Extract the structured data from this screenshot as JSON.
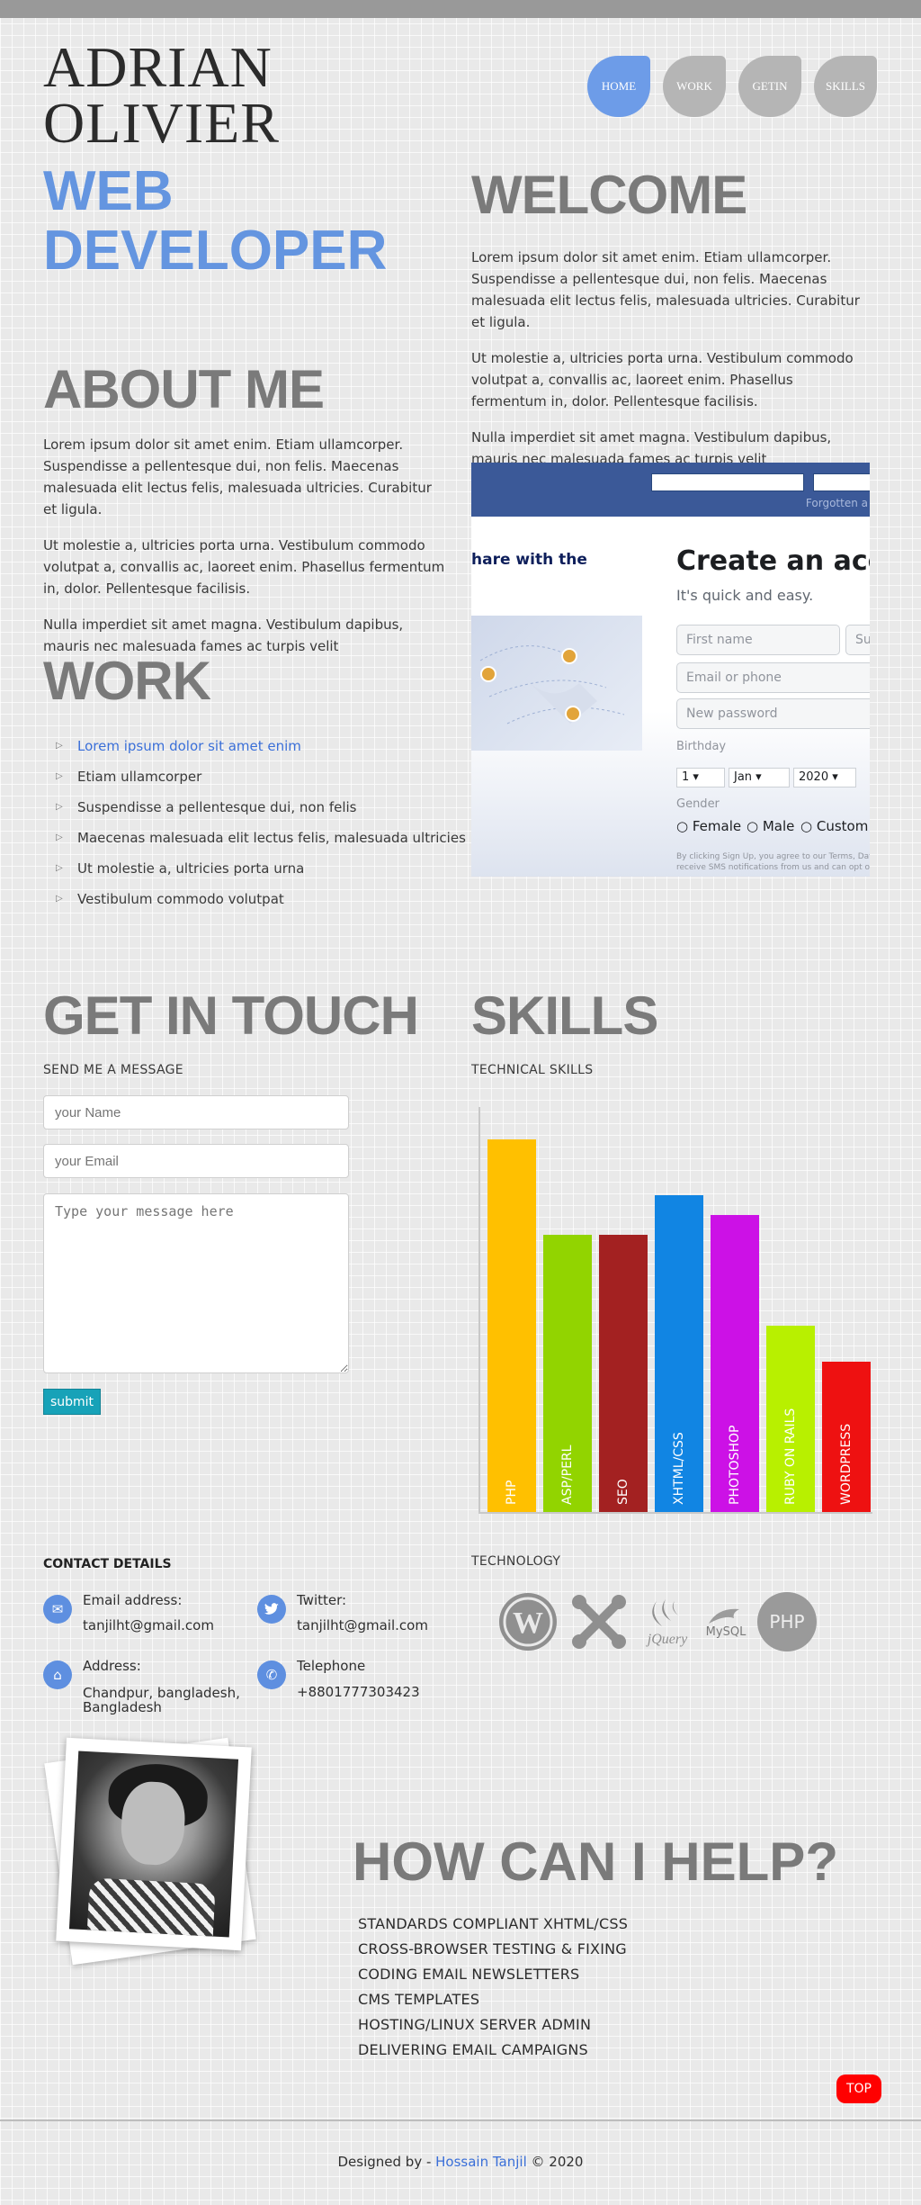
{
  "header": {
    "name_line1": "ADRIAN",
    "name_line2": "OLIVIER",
    "role_line1": "WEB",
    "role_line2": "DEVELOPER"
  },
  "nav": {
    "items": [
      "HOME",
      "WORK",
      "GETIN",
      "SKILLS"
    ],
    "active": "HOME"
  },
  "about": {
    "title": "ABOUT ME",
    "paragraphs": [
      "Lorem ipsum dolor sit amet enim. Etiam ullamcorper. Suspendisse a pellentesque dui, non felis. Maecenas malesuada elit lectus felis, malesuada ultricies. Curabitur et ligula.",
      "Ut molestie a, ultricies porta urna. Vestibulum commodo volutpat a, convallis ac, laoreet enim. Phasellus fermentum in, dolor. Pellentesque facilisis.",
      "Nulla imperdiet sit amet magna. Vestibulum dapibus, mauris nec malesuada fames ac turpis velit"
    ]
  },
  "welcome": {
    "title": "WELCOME",
    "paragraphs": [
      "Lorem ipsum dolor sit amet enim. Etiam ullamcorper. Suspendisse a pellentesque dui, non felis. Maecenas malesuada elit lectus felis, malesuada ultricies. Curabitur et ligula.",
      "Ut molestie a, ultricies porta urna. Vestibulum commodo volutpat a, convallis ac, laoreet enim. Phasellus fermentum in, dolor. Pellentesque facilisis.",
      "Nulla imperdiet sit amet magna. Vestibulum dapibus, mauris nec malesuada fames ac turpis velit"
    ]
  },
  "work": {
    "title": "WORK",
    "items": [
      "Lorem ipsum dolor sit amet enim",
      "Etiam ullamcorper",
      "Suspendisse a pellentesque dui, non felis",
      "Maecenas malesuada elit lectus felis, malesuada ultricies",
      "Ut molestie a, ultricies porta urna",
      "Vestibulum commodo volutpat"
    ]
  },
  "fb_preview": {
    "forgotten": "Forgotten a",
    "share": "hare with the",
    "create": "Create an acco",
    "quick": "It's quick and easy.",
    "first_name": "First name",
    "surname": "Su",
    "email_phone": "Email or phone",
    "new_password": "New password",
    "birthday": "Birthday",
    "day": "1",
    "month": "Jan",
    "year": "2020",
    "gender": "Gender",
    "female": "Female",
    "male": "Male",
    "custom": "Custom",
    "terms1": "By clicking Sign Up, you agree to our Terms, Data",
    "terms2": "receive SMS notifications from us and can opt ou"
  },
  "contact_form": {
    "title": "GET IN TOUCH",
    "subtitle": "SEND ME A MESSAGE",
    "name_placeholder": "your Name",
    "email_placeholder": "your Email",
    "message_placeholder": "Type your message here",
    "submit": "submit"
  },
  "skills": {
    "title": "SKILLS",
    "subtitle": "TECHNICAL SKILLS"
  },
  "chart_data": {
    "type": "bar",
    "categories": [
      "PHP",
      "ASP/PERL",
      "SEO",
      "XHTML/CSS",
      "PHOTOSHOP",
      "RUBY ON RAILS",
      "WORDPRESS"
    ],
    "values": [
      94,
      70,
      70,
      80,
      75,
      47,
      38
    ],
    "colors": [
      "#ffc000",
      "#92d400",
      "#a32121",
      "#1185e3",
      "#cc11e6",
      "#b8f000",
      "#ee1111"
    ],
    "ylim": [
      0,
      100
    ],
    "title": "",
    "xlabel": "",
    "ylabel": ""
  },
  "contact": {
    "title": "CONTACT DETAILS",
    "email_label": "Email address:",
    "email_value": "tanjilht@gmail.com",
    "twitter_label": "Twitter:",
    "twitter_value": "tanjilht@gmail.com",
    "address_label": "Address:",
    "address_value": "Chandpur, bangladesh, Bangladesh",
    "phone_label": "Telephone",
    "phone_value": "+8801777303423"
  },
  "technology": {
    "title": "TECHNOLOGY",
    "logos": [
      "wordpress-logo",
      "joomla-logo",
      "jquery-logo",
      "mysql-logo",
      "php-logo"
    ],
    "jquery_text": "jQuery",
    "mysql_text": "MySQL",
    "php_text": "PHP"
  },
  "help": {
    "title": "HOW CAN I HELP?",
    "items": [
      "STANDARDS COMPLIANT XHTML/CSS",
      "CROSS-BROWSER TESTING & FIXING",
      "CODING EMAIL NEWSLETTERS",
      "CMS TEMPLATES",
      "HOSTING/LINUX SERVER ADMIN",
      "DELIVERING EMAIL CAMPAIGNS"
    ]
  },
  "top_button": "TOP",
  "footer": {
    "prefix": "Designed by - ",
    "author": "Hossain Tanjil",
    "suffix": " © 2020"
  }
}
